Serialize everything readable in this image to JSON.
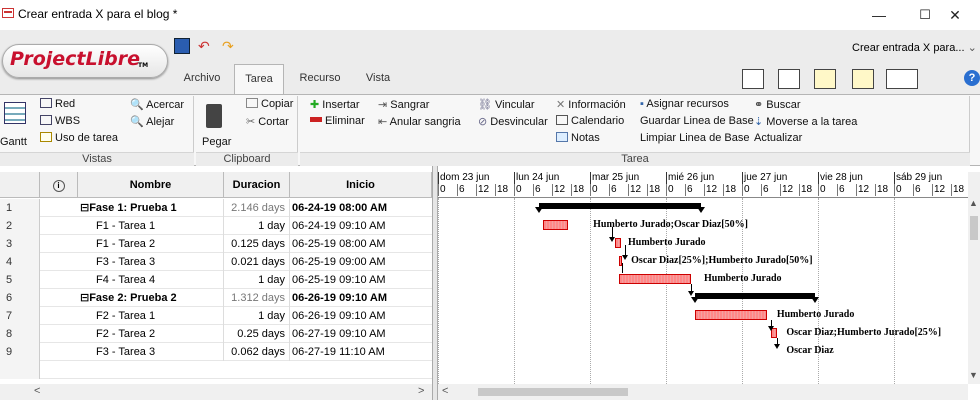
{
  "window": {
    "title": "Crear entrada X para el blog *",
    "min": "—",
    "max": "☐",
    "close": "✕"
  },
  "logo": {
    "text": "ProjectLibre",
    "tm": "TM"
  },
  "tabs": [
    "Archivo",
    "Tarea",
    "Recurso",
    "Vista"
  ],
  "project_select": "Crear entrada X para... ",
  "ribbon": {
    "vistas": {
      "gantt": "Gantt",
      "red": "Red",
      "wbs": "WBS",
      "uso": "Uso de tarea",
      "acercar": "Acercar",
      "alejar": "Alejar",
      "label": "Vistas"
    },
    "clipboard": {
      "pegar": "Pegar",
      "copiar": "Copiar",
      "cortar": "Cortar",
      "label": "Clipboard"
    },
    "tarea": {
      "insertar": "Insertar",
      "eliminar": "Eliminar",
      "sangrar": "Sangrar",
      "anular": "Anular sangria",
      "vincular": "Vincular",
      "desvincular": "Desvincular",
      "informacion": "Información",
      "calendario": "Calendario",
      "notas": "Notas",
      "asignar": "Asignar recursos",
      "guardar": "Guardar Linea de Base",
      "limpiar": "Limpiar Linea de Base",
      "buscar": "Buscar",
      "moverse": "Moverse a la tarea",
      "actualizar": "Actualizar",
      "label": "Tarea"
    }
  },
  "grid": {
    "headers": {
      "nombre": "Nombre",
      "duracion": "Duracion",
      "inicio": "Inicio"
    },
    "rows": [
      {
        "n": "1",
        "name": "⊟Fase 1: Prueba 1",
        "dur": "2.146 days",
        "start": "06-24-19 08:00 AM",
        "summary": true
      },
      {
        "n": "2",
        "name": "F1 - Tarea 1",
        "dur": "1 day",
        "start": "06-24-19 09:10 AM",
        "summary": false
      },
      {
        "n": "3",
        "name": "F1 - Tarea 2",
        "dur": "0.125 days",
        "start": "06-25-19 08:00 AM",
        "summary": false
      },
      {
        "n": "4",
        "name": "F3 - Tarea 3",
        "dur": "0.021 days",
        "start": "06-25-19 09:00 AM",
        "summary": false
      },
      {
        "n": "5",
        "name": "F4 - Tarea 4",
        "dur": "1 day",
        "start": "06-25-19 09:10 AM",
        "summary": false
      },
      {
        "n": "6",
        "name": "⊟Fase 2: Prueba 2",
        "dur": "1.312 days",
        "start": "06-26-19 09:10 AM",
        "summary": true
      },
      {
        "n": "7",
        "name": "F2 - Tarea 1",
        "dur": "1 day",
        "start": "06-26-19 09:10 AM",
        "summary": false
      },
      {
        "n": "8",
        "name": "F2 - Tarea 2",
        "dur": "0.25 days",
        "start": "06-27-19 09:10 AM",
        "summary": false
      },
      {
        "n": "9",
        "name": "F3 - Tarea 3",
        "dur": "0.062 days",
        "start": "06-27-19 11:10 AM",
        "summary": false
      }
    ]
  },
  "gantt": {
    "days": [
      "dom 23 jun",
      "lun 24 jun",
      "mar 25 jun",
      "mié 26 jun",
      "jue 27 jun",
      "vie 28 jun",
      "sáb 29 jun"
    ],
    "hours": [
      "0",
      "6",
      "12",
      "18"
    ],
    "labels": [
      "Humberto Jurado;Oscar Diaz[50%]",
      "Humberto Jurado",
      "Oscar Diaz[25%];Humberto Jurado[50%]",
      "Humberto Jurado",
      "Humberto Jurado",
      "Oscar Diaz;Humberto Jurado[25%]",
      "Oscar Diaz"
    ]
  }
}
